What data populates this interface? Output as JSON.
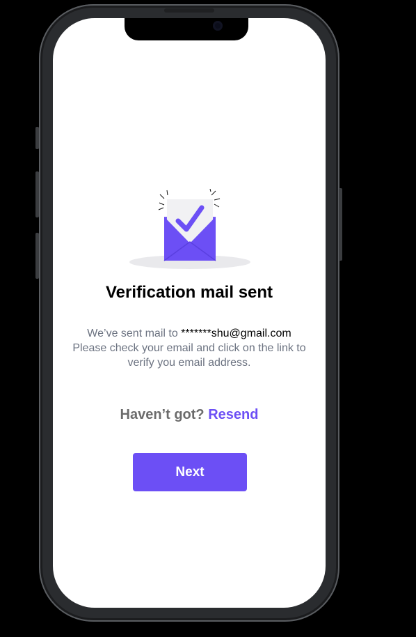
{
  "screen": {
    "title": "Verification mail sent",
    "message": {
      "line1_prefix": "We’ve sent mail to ",
      "masked_email": "*******shu@gmail.com",
      "line2": "Please check your email and click on the link to verify you email address."
    },
    "resend": {
      "prompt": "Haven’t got?",
      "link_label": "Resend"
    },
    "next_button_label": "Next"
  },
  "icons": {
    "illustration": "envelope-checkmark-icon"
  },
  "colors": {
    "accent": "#6c4ff5",
    "title": "#000000",
    "body_text": "#6b7280",
    "prompt_text": "#6b6b6b",
    "screen_background": "#ffffff",
    "page_background": "#000000"
  }
}
